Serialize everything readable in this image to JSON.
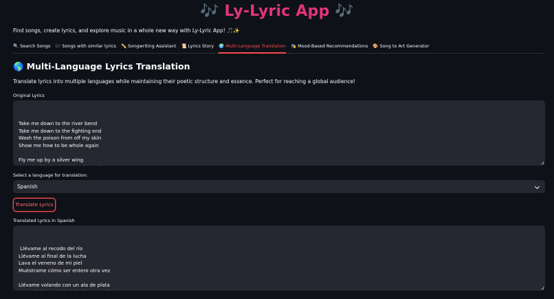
{
  "app": {
    "title": "🎶 Ly-Lyric App 🎶",
    "tagline": "Find songs, create lyrics, and explore music in a whole new way with Ly-Lyric App! 🎵✨"
  },
  "tabs": [
    {
      "icon": "🔍",
      "label": "Search Songs"
    },
    {
      "icon": "🎶",
      "label": "Songs with similar lyrics"
    },
    {
      "icon": "✏️",
      "label": "Songwriting Assistant"
    },
    {
      "icon": "📜",
      "label": "Lyrics Story"
    },
    {
      "icon": "🌍",
      "label": "Multi-Language Translation"
    },
    {
      "icon": "🎭",
      "label": "Mood-Based Recommendations"
    },
    {
      "icon": "🎨",
      "label": "Song to Art Generator"
    }
  ],
  "active_tab_index": 4,
  "section": {
    "icon": "🌎",
    "title": "Multi-Language Lyrics Translation",
    "description": "Translate lyrics into multiple languages while maintaining their poetic structure and essence. Perfect for reaching a global audience!"
  },
  "original": {
    "label": "Original Lyrics",
    "text": "Take me down to the river bend\nTake me down to the fighting end\nWash the poison from off my skin\nShow me how to be whole again\n\nFly me up by a silver wing\nPast the black where the sirens sing\nWarm me up in a nova's glow"
  },
  "language": {
    "label": "Select a language for translation:",
    "selected": "Spanish"
  },
  "translate_button": "Translate Lyrics",
  "translated": {
    "label": "Translated Lyrics in Spanish",
    "text": " Llévame al recodo del río\nLlévame al final de la lucha\nLava el veneno de mi piel\nMuéstrame cómo ser entero otra vez\n\nLlévame volando con un ala de plata\nPasando la oscuridad donde cantan las sirenas\nCalienta mi ser con el resplandor de una nova"
  },
  "colors": {
    "accent": "#ff4b4b",
    "title": "#e0357a",
    "background": "#0e1117",
    "input_bg": "#262730"
  }
}
